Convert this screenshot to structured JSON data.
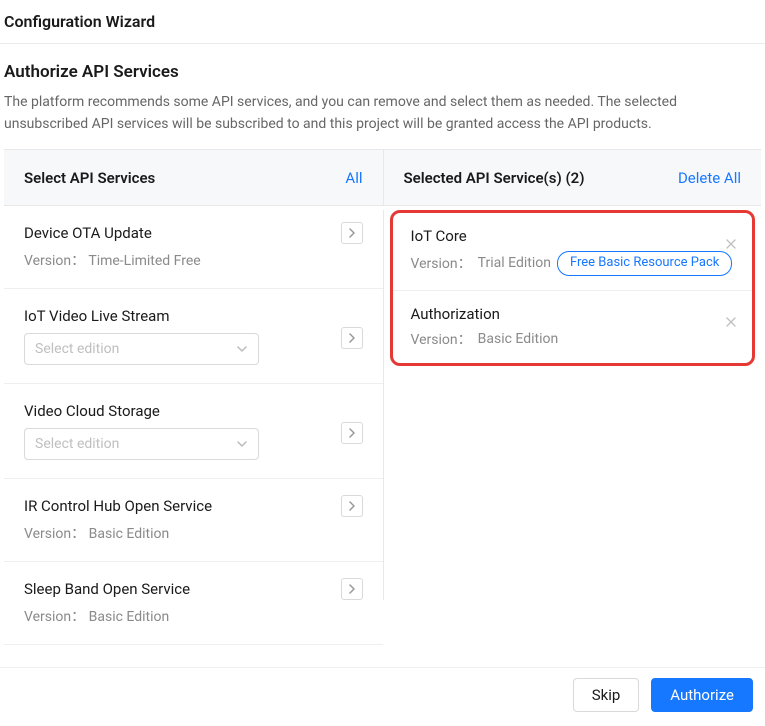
{
  "header": {
    "title": "Configuration Wizard"
  },
  "section": {
    "title": "Authorize API Services",
    "desc": "The platform recommends some API services, and you can remove and select them as needed. The selected unsubscribed API services will be subscribed to and this project will be granted access the API products."
  },
  "left": {
    "title": "Select API Services",
    "all_label": "All",
    "version_label": "Version：",
    "items": [
      {
        "name": "Device OTA Update",
        "version": "Time-Limited Free",
        "has_select": false
      },
      {
        "name": "IoT Video Live Stream",
        "select_placeholder": "Select edition",
        "has_select": true
      },
      {
        "name": "Video Cloud Storage",
        "select_placeholder": "Select edition",
        "has_select": true
      },
      {
        "name": "IR Control Hub Open Service",
        "version": "Basic Edition",
        "has_select": false
      },
      {
        "name": "Sleep Band Open Service",
        "version": "Basic Edition",
        "has_select": false
      }
    ]
  },
  "right": {
    "title": "Selected API Service(s) (2)",
    "delete_all_label": "Delete All",
    "version_label": "Version：",
    "items": [
      {
        "name": "IoT Core",
        "version": "Trial Edition",
        "badge": "Free Basic Resource Pack"
      },
      {
        "name": "Authorization",
        "version": "Basic Edition"
      }
    ]
  },
  "footer": {
    "skip": "Skip",
    "authorize": "Authorize"
  }
}
